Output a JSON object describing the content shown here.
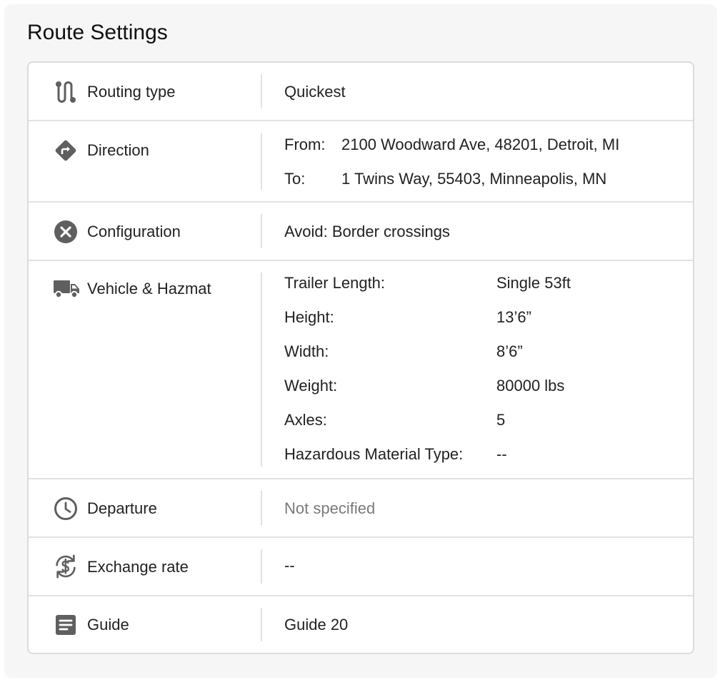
{
  "title": "Route Settings",
  "rows": {
    "routing": {
      "label": "Routing type",
      "icon": "route-icon",
      "value": "Quickest"
    },
    "direction": {
      "label": "Direction",
      "icon": "direction-icon",
      "from_label": "From:",
      "from_value": "2100 Woodward Ave, 48201, Detroit, MI",
      "to_label": "To:",
      "to_value": "1 Twins Way, 55403, Minneapolis, MN"
    },
    "configuration": {
      "label": "Configuration",
      "icon": "close-circle-icon",
      "value": "Avoid: Border crossings"
    },
    "vehicle": {
      "label": "Vehicle & Hazmat",
      "icon": "truck-icon",
      "items": [
        {
          "key": "Trailer Length:",
          "value": "Single 53ft"
        },
        {
          "key": "Height:",
          "value": "13’6”"
        },
        {
          "key": "Width:",
          "value": "8’6”"
        },
        {
          "key": "Weight:",
          "value": "80000 lbs"
        },
        {
          "key": "Axles:",
          "value": "5"
        },
        {
          "key": "Hazardous Material Type:",
          "value": "--"
        }
      ]
    },
    "departure": {
      "label": "Departure",
      "icon": "clock-icon",
      "value": "Not specified"
    },
    "exchange": {
      "label": "Exchange rate",
      "icon": "currency-exchange-icon",
      "value": "--"
    },
    "guide": {
      "label": "Guide",
      "icon": "document-icon",
      "value": "Guide 20"
    }
  },
  "colors": {
    "icon": "#5f5f5f",
    "muted": "#7a7a7a",
    "border": "#e2e2e2",
    "panel": "#f6f6f6"
  }
}
